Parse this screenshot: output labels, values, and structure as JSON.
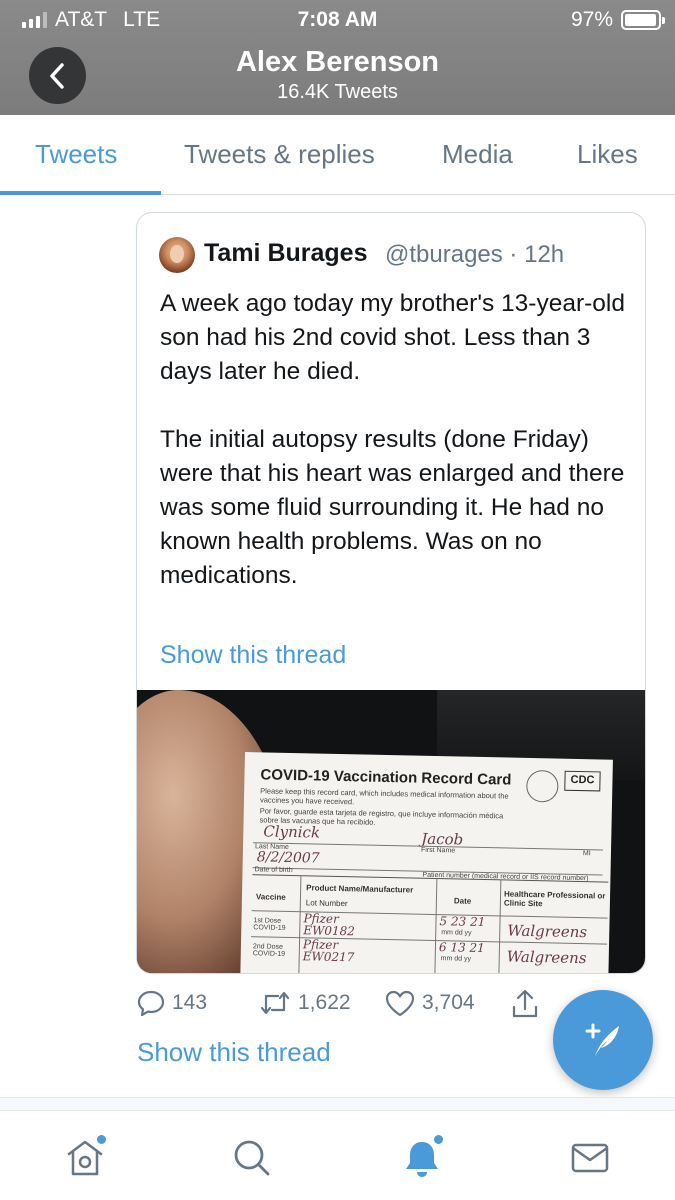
{
  "status_bar": {
    "carrier": "AT&T",
    "network": "LTE",
    "time": "7:08 AM",
    "battery": "97%",
    "battery_level": 0.97,
    "signal_bars_filled": 3,
    "signal_bars_total": 4
  },
  "header": {
    "back_icon": "chevron-left-icon",
    "profile_name": "Alex Berenson",
    "tweet_count": "16.4K Tweets"
  },
  "tabs": [
    {
      "label": "Tweets",
      "active": true
    },
    {
      "label": "Tweets & replies",
      "active": false
    },
    {
      "label": "Media",
      "active": false
    },
    {
      "label": "Likes",
      "active": false
    }
  ],
  "quoted_tweet": {
    "author_name": "Tami Burages",
    "handle_time": "@tburages · 12h",
    "paragraphs": [
      "A week ago today my brother's 13-year-old son had his 2nd covid shot. Less than 3 days later he died.",
      "The initial autopsy results (done Friday) were that his heart was enlarged and there was some fluid surrounding it. He had no known health problems. Was on no medications."
    ],
    "show_thread": "Show this thread",
    "photo": {
      "card_title": "COVID-19 Vaccination Record Card",
      "card_instructions_en": "Please keep this record card, which includes medical information about the vaccines you have received.",
      "card_instructions_es": "Por favor, guarde esta tarjeta de registro, que incluye información médica sobre las vacunas que ha recibido.",
      "cdc_logo": "CDC",
      "last_name_value": "Clynick",
      "first_name_value": "Jacob",
      "last_name_label": "Last Name",
      "first_name_label": "First Name",
      "mi_label": "MI",
      "dob_value": "8/2/2007",
      "dob_label": "Date of birth",
      "patient_number_label": "Patient number (medical record or IIS record number)",
      "col_vaccine": "Vaccine",
      "col_product": "Product Name/Manufacturer",
      "col_lot": "Lot Number",
      "col_date": "Date",
      "col_site": "Healthcare Professional or Clinic Site",
      "dose1_label": "1st Dose COVID-19",
      "dose1_product": "Pfizer",
      "dose1_lot": "EW0182",
      "dose1_date": "5 23 21",
      "dose1_site": "Walgreens",
      "dose2_label": "2nd Dose COVID-19",
      "dose2_product": "Pfizer",
      "dose2_lot": "EW0217",
      "dose2_date": "6 13 21",
      "dose2_site": "Walgreens",
      "date_hint": "mm dd yy"
    }
  },
  "actions": {
    "reply_icon": "reply-icon",
    "reply_count": "143",
    "retweet_icon": "retweet-icon",
    "retweet_count": "1,622",
    "like_icon": "heart-icon",
    "like_count": "3,704",
    "share_icon": "share-icon"
  },
  "thread_link": "Show this thread",
  "fab": {
    "icon": "compose-tweet-icon"
  },
  "bottom_nav": [
    {
      "icon": "home-icon",
      "has_dot": true
    },
    {
      "icon": "search-icon",
      "has_dot": false
    },
    {
      "icon": "notifications-bell-icon",
      "has_dot": true,
      "active": true
    },
    {
      "icon": "messages-envelope-icon",
      "has_dot": false
    }
  ],
  "colors": {
    "accent": "#4a9ad9",
    "header_bg": "#7c7c7c",
    "text_secondary": "#657786"
  }
}
